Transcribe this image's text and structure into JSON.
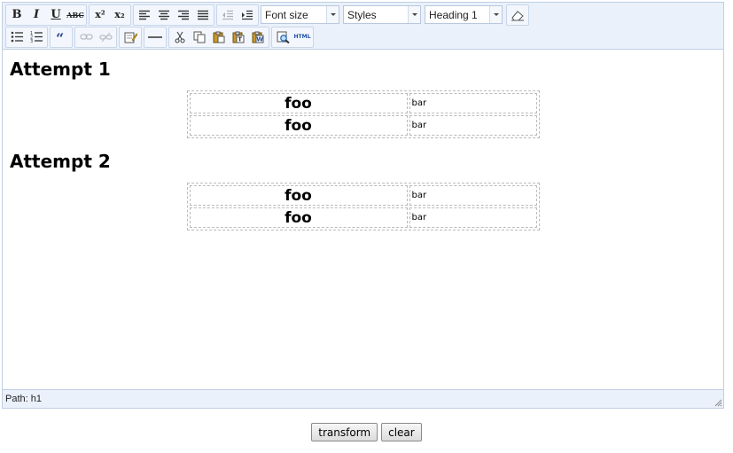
{
  "toolbar": {
    "bold": "B",
    "italic": "I",
    "underline": "U",
    "strike": "ABC",
    "superscript": "x²",
    "subscript": "x₂",
    "font_size_label": "Font size",
    "styles_label": "Styles",
    "format_label": "Heading 1",
    "html_label": "HTML"
  },
  "content": {
    "attempt1_title": "Attempt 1",
    "attempt2_title": "Attempt 2",
    "table1": [
      [
        "foo",
        "bar"
      ],
      [
        "foo",
        "bar"
      ]
    ],
    "table2": [
      [
        "foo",
        "bar"
      ],
      [
        "foo",
        "bar"
      ]
    ]
  },
  "status": {
    "path": "Path: h1"
  },
  "actions": {
    "transform": "transform",
    "clear": "clear"
  }
}
